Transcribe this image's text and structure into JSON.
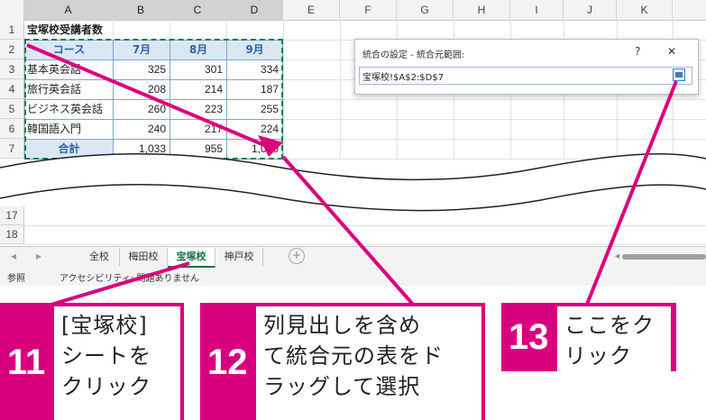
{
  "columns": [
    "A",
    "B",
    "C",
    "D",
    "E",
    "F",
    "G",
    "H",
    "I",
    "J",
    "K"
  ],
  "rows_top": [
    "1",
    "2",
    "3",
    "4",
    "5",
    "6",
    "7"
  ],
  "rows_bottom": [
    "17",
    "18"
  ],
  "sheet": {
    "title": "宝塚校受講者数",
    "headers": [
      "コース",
      "7月",
      "8月",
      "9月"
    ],
    "rows": [
      [
        "基本英会話",
        "325",
        "301",
        "334"
      ],
      [
        "旅行英会話",
        "208",
        "214",
        "187"
      ],
      [
        "ビジネス英会話",
        "260",
        "223",
        "255"
      ],
      [
        "韓国語入門",
        "240",
        "217",
        "224"
      ]
    ],
    "total": [
      "合計",
      "1,033",
      "955",
      "1,000"
    ]
  },
  "dialog": {
    "title": "統合の設定 - 統合元範囲:",
    "help": "?",
    "close": "✕",
    "range_value": "宝塚校!$A$2:$D$7"
  },
  "tabs": [
    "全校",
    "梅田校",
    "宝塚校",
    "神戸校"
  ],
  "active_tab": "宝塚校",
  "add_sheet": "+",
  "status": {
    "mode": "参照",
    "accessibility": "アクセシビリティ: 問題ありません"
  },
  "callouts": [
    {
      "num": "11",
      "lines": [
        "[宝塚校]",
        "シートを",
        "クリック"
      ]
    },
    {
      "num": "12",
      "lines": [
        "列見出しを含め",
        "て統合元の表をド",
        "ラッグして選択"
      ]
    },
    {
      "num": "13",
      "lines": [
        "ここをク",
        "リック"
      ]
    }
  ],
  "colors": {
    "accent": "#d9007e",
    "header_fill": "#dbe7f3",
    "header_text": "#2e64a6",
    "active_tab": "#1e7145"
  }
}
